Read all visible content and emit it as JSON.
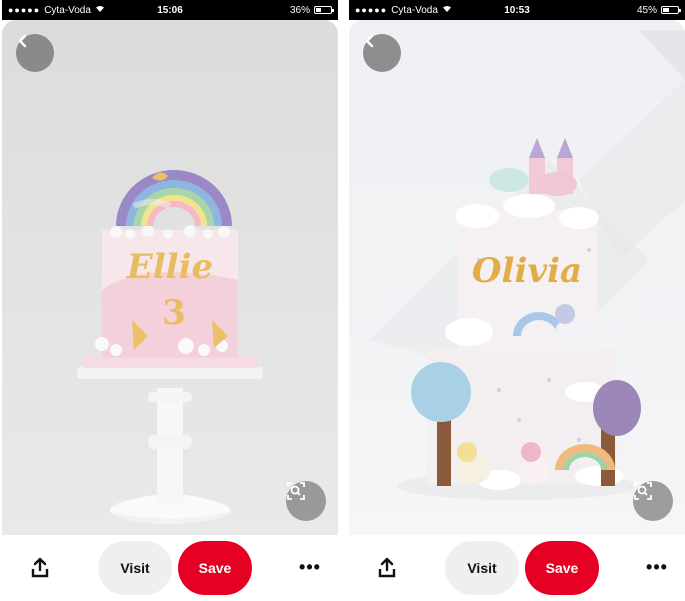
{
  "screens": [
    {
      "status": {
        "carrier": "Cyta-Voda",
        "time": "15:06",
        "battery": "36%",
        "battery_level": 0.36
      },
      "cake_text": {
        "name": "Ellie",
        "age": "3"
      },
      "actions": {
        "visit": "Visit",
        "save": "Save",
        "more": "•••"
      }
    },
    {
      "status": {
        "carrier": "Cyta-Voda",
        "time": "10:53",
        "battery": "45%",
        "battery_level": 0.45
      },
      "cake_text": {
        "name": "Olivia"
      },
      "actions": {
        "visit": "Visit",
        "save": "Save",
        "more": "•••"
      }
    }
  ],
  "icons": {
    "back": "chevron-left-icon",
    "lens": "visual-search-icon",
    "share": "share-icon",
    "more": "more-options-icon",
    "wifi": "wifi-icon",
    "signal": "signal-dots-icon"
  },
  "colors": {
    "save_button": "#e60023",
    "visit_button": "#efefef"
  }
}
